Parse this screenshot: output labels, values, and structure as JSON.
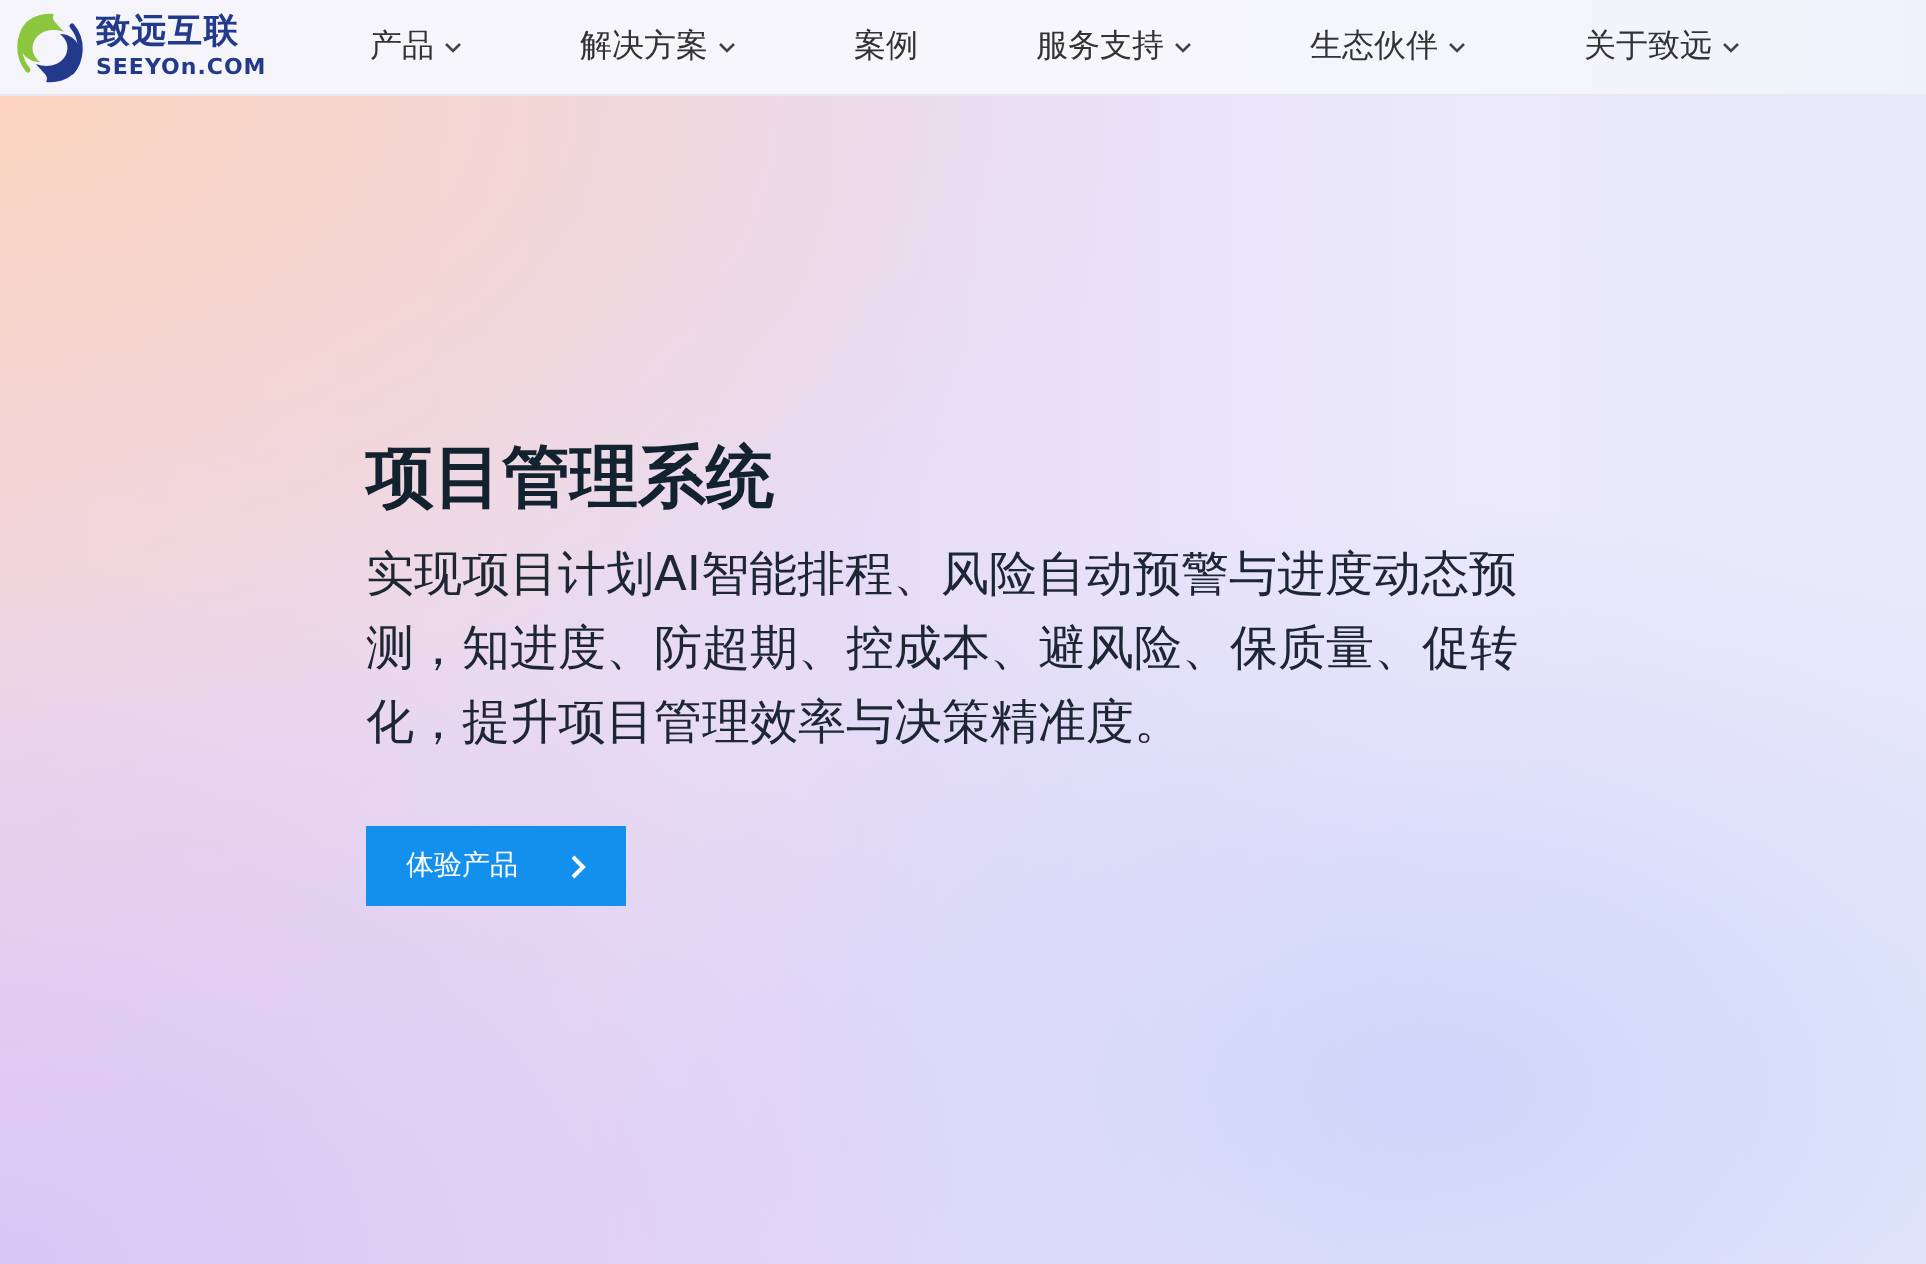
{
  "logo": {
    "name": "致远互联",
    "url": "SEEYOn.COM"
  },
  "nav": [
    {
      "label": "产品",
      "has_menu": true
    },
    {
      "label": "解决方案",
      "has_menu": true
    },
    {
      "label": "案例",
      "has_menu": false
    },
    {
      "label": "服务支持",
      "has_menu": true
    },
    {
      "label": "生态伙伴",
      "has_menu": true
    },
    {
      "label": "关于致远",
      "has_menu": true
    }
  ],
  "hero": {
    "title": "项目管理系统",
    "description": "实现项目计划AI智能排程、风险自动预警与进度动态预测，知进度、防超期、控成本、避风险、保质量、促转化，提升项目管理效率与决策精准度。",
    "button": "体验产品"
  }
}
